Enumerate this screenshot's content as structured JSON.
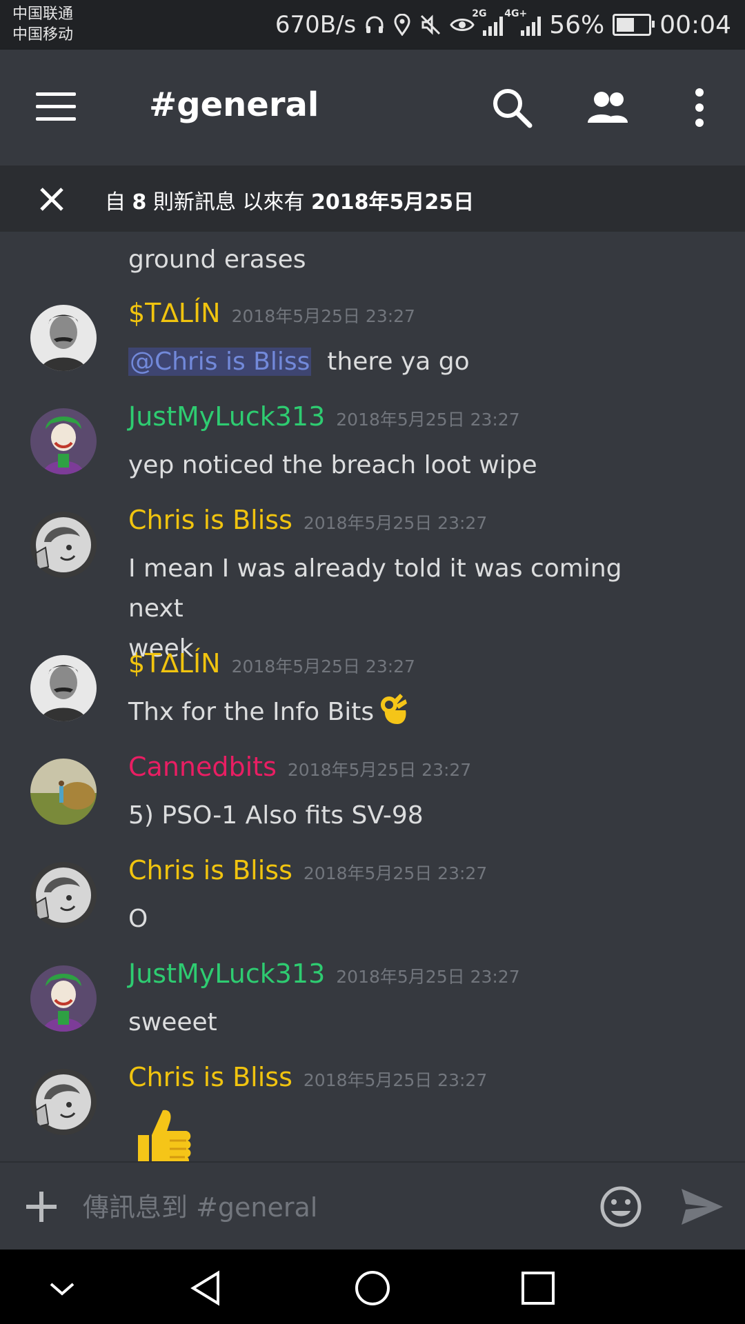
{
  "status_bar": {
    "carrier_1": "中国联通",
    "carrier_2": "中国移动",
    "net_speed": "670B/s",
    "signal_1_tag": "2G",
    "signal_2_tag": "4G+",
    "battery_percent": "56%",
    "battery_level": 0.56,
    "time": "00:04",
    "icons": [
      "headset-icon",
      "location-icon",
      "mute-icon",
      "eye-icon",
      "signal-icon",
      "battery-icon"
    ]
  },
  "toolbar": {
    "channel_title": "#general",
    "icons": [
      "menu-icon",
      "search-icon",
      "members-icon",
      "overflow-icon"
    ]
  },
  "new_messages_bar": {
    "prefix": "自 ",
    "count": "8",
    "middle": " 則新訊息 以來有 ",
    "date": "2018年5月25日"
  },
  "partial_message": "ground erases",
  "messages": [
    {
      "author": "$T∆LÍN",
      "author_color": "#f1c40f",
      "timestamp": "2018年5月25日 23:27",
      "mention": "@Chris is Bliss",
      "text": "there ya go",
      "avatar": "stalin-avatar"
    },
    {
      "author": "JustMyLuck313",
      "author_color": "#2ecc71",
      "timestamp": "2018年5月25日 23:27",
      "text": "yep noticed the breach loot wipe",
      "avatar": "joker-avatar"
    },
    {
      "author": "Chris is Bliss",
      "author_color": "#f1c40f",
      "timestamp": "2018年5月25日 23:27",
      "text_line_1": "I mean I was already told it was coming next",
      "text_line_2": "week",
      "avatar": "vault-boy-avatar"
    },
    {
      "author": "$T∆LÍN",
      "author_color": "#f1c40f",
      "timestamp": "2018年5月25日 23:27",
      "text": "Thx for the Info Bits",
      "emoji": "ok-hand-emoji",
      "avatar": "stalin-avatar"
    },
    {
      "author": "Cannedbits",
      "author_color": "#e91e63",
      "timestamp": "2018年5月25日 23:27",
      "text": "5) PSO-1 Also fits SV-98",
      "avatar": "field-avatar"
    },
    {
      "author": "Chris is Bliss",
      "author_color": "#f1c40f",
      "timestamp": "2018年5月25日 23:27",
      "text": "O",
      "avatar": "vault-boy-avatar"
    },
    {
      "author": "JustMyLuck313",
      "author_color": "#2ecc71",
      "timestamp": "2018年5月25日 23:27",
      "text": "sweeet",
      "avatar": "joker-avatar"
    },
    {
      "author": "Chris is Bliss",
      "author_color": "#f1c40f",
      "timestamp": "2018年5月25日 23:27",
      "emoji": "thumbs-up-emoji",
      "avatar": "vault-boy-avatar"
    }
  ],
  "composer": {
    "placeholder": "傳訊息到 #general",
    "icons": [
      "plus-icon",
      "emoji-icon",
      "send-icon"
    ]
  },
  "nav_bar": {
    "icons": [
      "collapse-icon",
      "back-icon",
      "home-icon",
      "recent-apps-icon"
    ]
  },
  "colors": {
    "background": "#36393f",
    "mention_text": "#7289da",
    "timestamp": "#72767d"
  }
}
